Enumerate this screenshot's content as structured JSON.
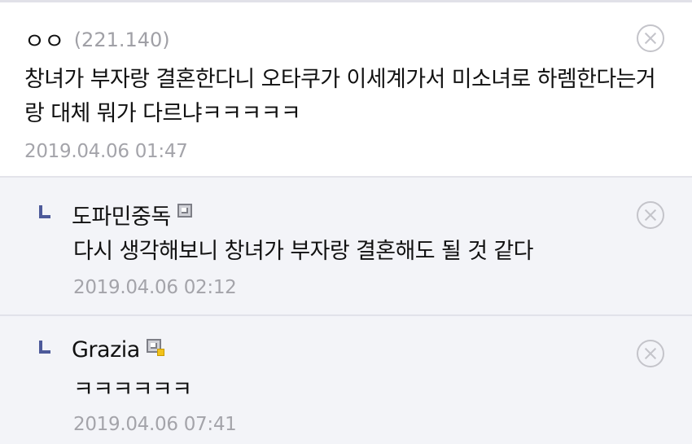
{
  "comments": [
    {
      "nickname": "ㅇㅇ",
      "ip": "(221.140)",
      "text": "창녀가 부자랑 결혼한다니 오타쿠가 이세계가서 미소녀로 하렘한다는거랑 대체 뭐가 다르냐ㅋㅋㅋㅋㅋ",
      "date": "2019.04.06 01:47",
      "delete_icon": "close-circle-icon"
    }
  ],
  "replies": [
    {
      "nickname": "도파민중독",
      "user_icon": "half-fixed-nick-icon",
      "text": "다시 생각해보니 창녀가 부자랑 결혼해도 될 것 같다",
      "date": "2019.04.06 02:12",
      "delete_icon": "close-circle-icon"
    },
    {
      "nickname": "Grazia",
      "user_icon": "fixed-nick-icon",
      "text": "ㅋㅋㅋㅋㅋㅋ",
      "date": "2019.04.06 07:41",
      "delete_icon": "close-circle-icon"
    }
  ],
  "colors": {
    "reply_background": "#f3f4f8",
    "reply_marker": "#4d5a9a",
    "meta_text": "#a4a4aa"
  }
}
